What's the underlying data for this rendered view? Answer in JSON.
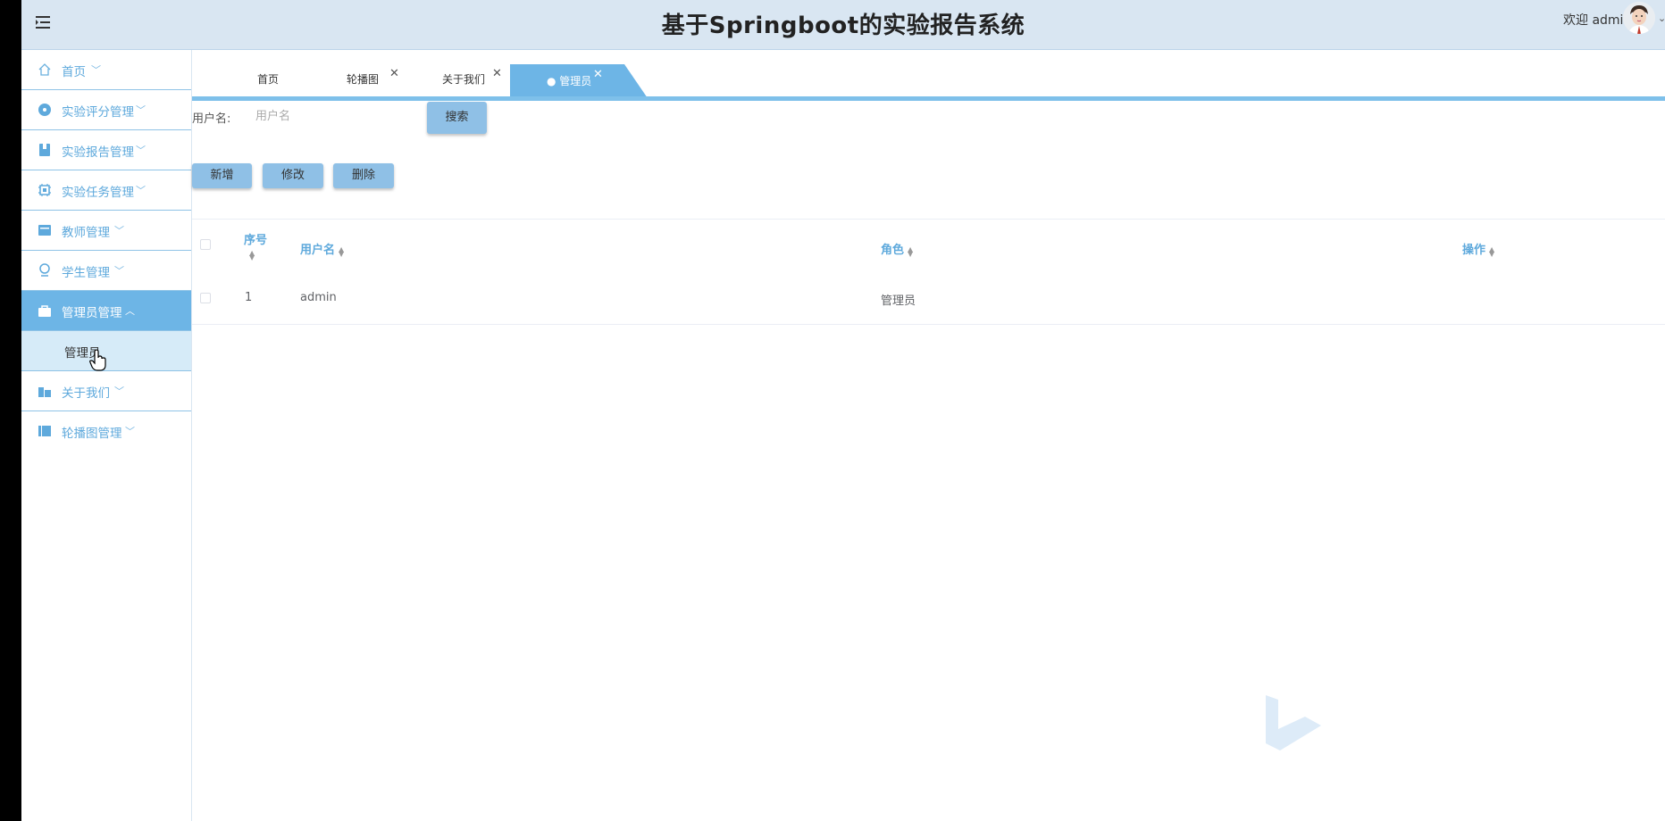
{
  "header": {
    "title": "基于Springboot的实验报告系统",
    "welcome": "欢迎 admin"
  },
  "sidebar": {
    "items": [
      {
        "label": "首页",
        "icon": "home-icon"
      },
      {
        "label": "实验评分管理",
        "icon": "disc-icon"
      },
      {
        "label": "实验报告管理",
        "icon": "book-icon"
      },
      {
        "label": "实验任务管理",
        "icon": "chip-icon"
      },
      {
        "label": "教师管理",
        "icon": "card-icon"
      },
      {
        "label": "学生管理",
        "icon": "person-icon"
      },
      {
        "label": "管理员管理",
        "icon": "bag-icon",
        "active": true
      },
      {
        "label": "关于我们",
        "icon": "building-icon"
      },
      {
        "label": "轮播图管理",
        "icon": "columns-icon"
      }
    ],
    "submenu": {
      "label": "管理员"
    }
  },
  "tabs": [
    {
      "label": "首页"
    },
    {
      "label": "轮播图"
    },
    {
      "label": "关于我们"
    },
    {
      "label": "管理员",
      "active": true
    }
  ],
  "search": {
    "label": "用户名:",
    "placeholder": "用户名",
    "button": "搜索"
  },
  "actions": {
    "add": "新增",
    "edit": "修改",
    "delete": "删除"
  },
  "table": {
    "columns": [
      "序号",
      "用户名",
      "角色",
      "操作"
    ],
    "rows": [
      {
        "index": "1",
        "username": "admin",
        "role": "管理员"
      }
    ]
  },
  "colors": {
    "accent": "#6db5e6",
    "header_bg": "#d9e6f2",
    "button_bg": "#8fc0e6"
  }
}
